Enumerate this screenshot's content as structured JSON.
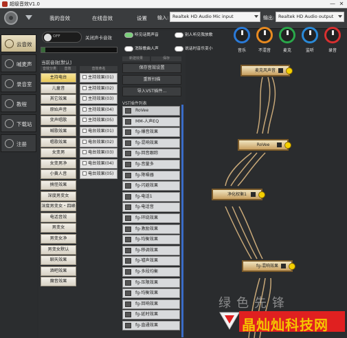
{
  "window": {
    "title": "超级音效V1.0",
    "minimize": "—",
    "close": "✕"
  },
  "topbar": {
    "tabs": [
      "我的音效",
      "在线音效",
      "设置"
    ],
    "input_label": "输入:",
    "input_device": "Realtek HD Audio Mic input",
    "output_label": "输出:",
    "output_device": "Realtek HD Audio output"
  },
  "sidebar": {
    "items": [
      {
        "label": "云音效",
        "active": true
      },
      {
        "label": "喊麦声",
        "active": false
      },
      {
        "label": "录音室",
        "active": false
      },
      {
        "label": "教程",
        "active": false
      },
      {
        "label": "下载站",
        "active": false
      },
      {
        "label": "注册",
        "active": false
      }
    ]
  },
  "effects": {
    "toggle_text": "OFF",
    "toggle_desc": "关闭声卡音效",
    "progress": 0.05,
    "category_title": "当前音效[默认]",
    "col_headers": [
      "音效分类",
      "音效",
      "音效命名"
    ],
    "categories": [
      "主持电台",
      "儿童音",
      "其它效果",
      "原始声音",
      "变声唱歌",
      "喊歌效果",
      "唱歌效果",
      "女变男",
      "女变男净",
      "小黄人音",
      "搞怪效果",
      "深度男变女",
      "深度男变女・四峰",
      "电话音效",
      "男变女",
      "男变女净",
      "男变女默认",
      "聊天效果",
      "酒吧效果",
      "魔音效果"
    ],
    "presets": [
      "主持效果(01)",
      "主持效果(02)",
      "主持效果(03)",
      "主持效果(04)",
      "主持效果(05)",
      "电台效果(01)",
      "电台效果(02)",
      "电台效果(03)",
      "电台效果(04)",
      "电台效果(05)"
    ]
  },
  "options": {
    "items": [
      {
        "label": "听见话筒声音",
        "on": true
      },
      {
        "label": "别人听见我放歌",
        "on": false
      },
      {
        "label": "消除歌曲人声",
        "on": false
      },
      {
        "label": "说话时音乐变小",
        "on": false
      }
    ]
  },
  "knobs": [
    {
      "label": "音乐",
      "color": "#2a7ad8"
    },
    {
      "label": "不混音",
      "color": "#e88a20"
    },
    {
      "label": "麦克",
      "color": "#2aa84a"
    },
    {
      "label": "监听",
      "color": "#2a8ad8"
    },
    {
      "label": "录音",
      "color": "#d83030"
    }
  ],
  "vst": {
    "headers": [
      "新建效果",
      "保存"
    ],
    "buttons": [
      "保存音效设置",
      "重新扫描",
      "导入VST插件..."
    ],
    "list_title": "VST插件列表",
    "plugins": [
      "RoVee",
      "MM-人声EQ",
      "fg-爆音效果",
      "fg-混响效果",
      "fg-回音跟踪",
      "fg-音量多",
      "fg-降噪器",
      "fg-闪避效果",
      "fg-电话1",
      "fg-电话音",
      "fg-环绕效果",
      "fg-激励效果",
      "fg-均衡效果",
      "fg-移调效果",
      "fg-嘘声效果",
      "fg-多段均衡",
      "fg-压限效果",
      "fg-均衡效果",
      "fg-回响效果",
      "fg-延时效果",
      "fg-直通效果"
    ]
  },
  "chain": {
    "nodes": [
      "麦克风声音",
      "RoVee",
      "净化权衡1",
      "fg-混响效果"
    ]
  },
  "watermark": {
    "title": "晶灿灿科技网",
    "shadow": "绿色先锋"
  }
}
